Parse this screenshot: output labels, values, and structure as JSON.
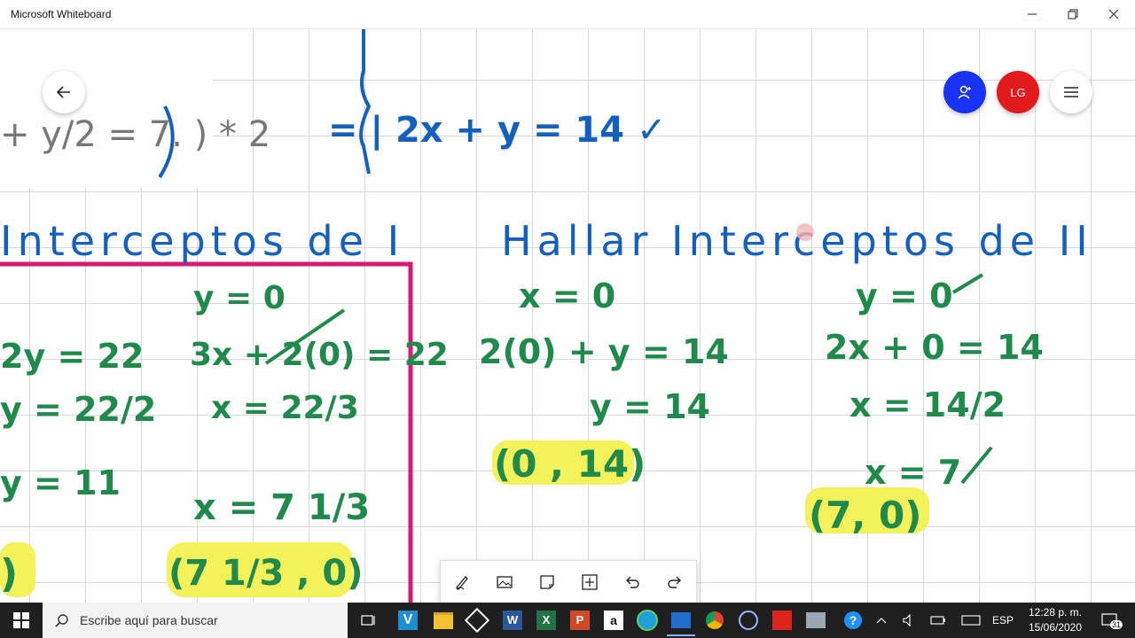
{
  "window": {
    "title": "Microsoft Whiteboard"
  },
  "header": {
    "avatar_initials": "LG",
    "colors": {
      "invite": "#1a33f2",
      "avatar": "#e11b1b"
    }
  },
  "toolbar": {
    "tools": [
      "pen-icon",
      "image-icon",
      "note-icon",
      "insert-icon",
      "undo-icon",
      "redo-icon"
    ]
  },
  "board": {
    "colors": {
      "blue_ink": "#1560bd",
      "green_ink": "#1f8a4c",
      "highlight": "#f4f25a",
      "pink_frame": "#d81b6f"
    },
    "top_partial": "+ y/2 = 7. ) * 2",
    "top_equation": "= | 2x + y = 14 ✓",
    "section1_title": "Interceptos de I",
    "section2_title": "Hallar Interceptos de II",
    "col_a": [
      "2y = 22",
      "y = 22/2",
      "y = 11",
      ")"
    ],
    "col_b": [
      "y = 0",
      "3x + 2(0) = 22",
      "x = 22/3",
      "x = 7 1/3",
      "(7 1/3 , 0)"
    ],
    "col_c": [
      "x = 0",
      "2(0) + y = 14",
      "y = 14",
      "(0 , 14)"
    ],
    "col_d": [
      "y = 0",
      "2x + 0 = 14",
      "x = 14/2",
      "x = 7",
      "(7, 0)"
    ]
  },
  "taskbar": {
    "search_placeholder": "Escribe aquí para buscar",
    "language": "ESP",
    "time": "12:28 p. m.",
    "date": "15/06/2020",
    "notifications": "31"
  }
}
